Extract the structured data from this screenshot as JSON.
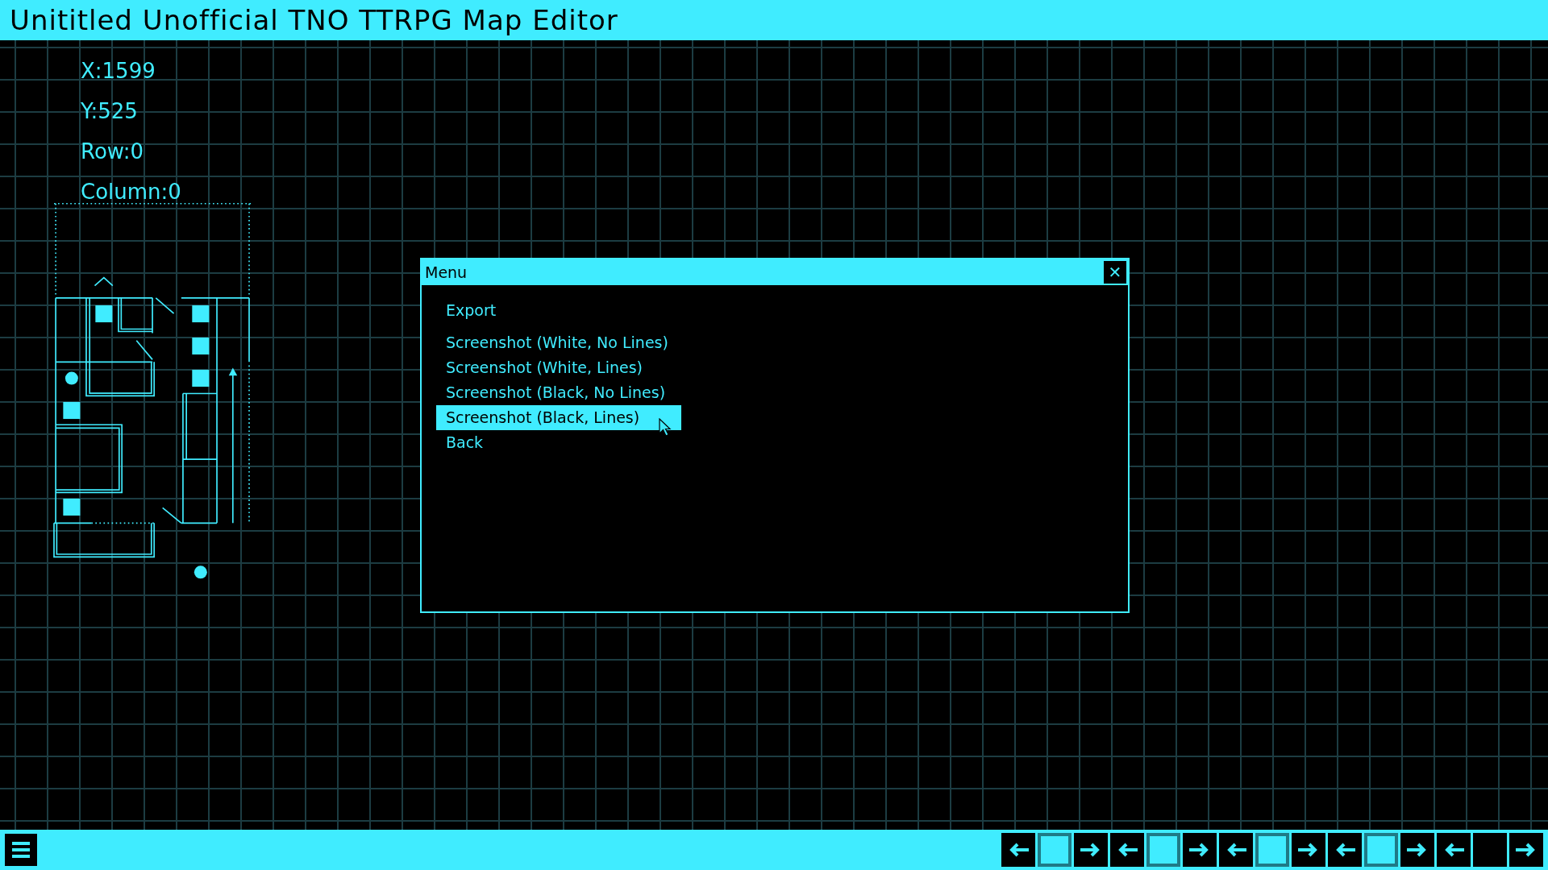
{
  "window": {
    "title": "Unititled Unofficial TNO TTRPG Map Editor"
  },
  "readout": [
    "X:1599",
    "Y:525",
    "Row:0",
    "Column:0"
  ],
  "menu": {
    "title": "Menu",
    "close": "✕",
    "heading": "Export",
    "items": [
      {
        "label": "Screenshot (White, No Lines)",
        "selected": false
      },
      {
        "label": "Screenshot (White, Lines)",
        "selected": false
      },
      {
        "label": "Screenshot (Black, No Lines)",
        "selected": false
      },
      {
        "label": "Screenshot (Black, Lines)",
        "selected": true
      },
      {
        "label": "Back",
        "selected": false
      }
    ]
  },
  "toolbar": [
    {
      "kind": "left"
    },
    {
      "kind": "slot",
      "filled": true
    },
    {
      "kind": "right"
    },
    {
      "kind": "left"
    },
    {
      "kind": "slot",
      "filled": true
    },
    {
      "kind": "right"
    },
    {
      "kind": "left"
    },
    {
      "kind": "slot",
      "filled": true
    },
    {
      "kind": "right"
    },
    {
      "kind": "left"
    },
    {
      "kind": "slot",
      "filled": true
    },
    {
      "kind": "right"
    },
    {
      "kind": "left"
    },
    {
      "kind": "slot",
      "filled": false
    },
    {
      "kind": "right"
    }
  ]
}
